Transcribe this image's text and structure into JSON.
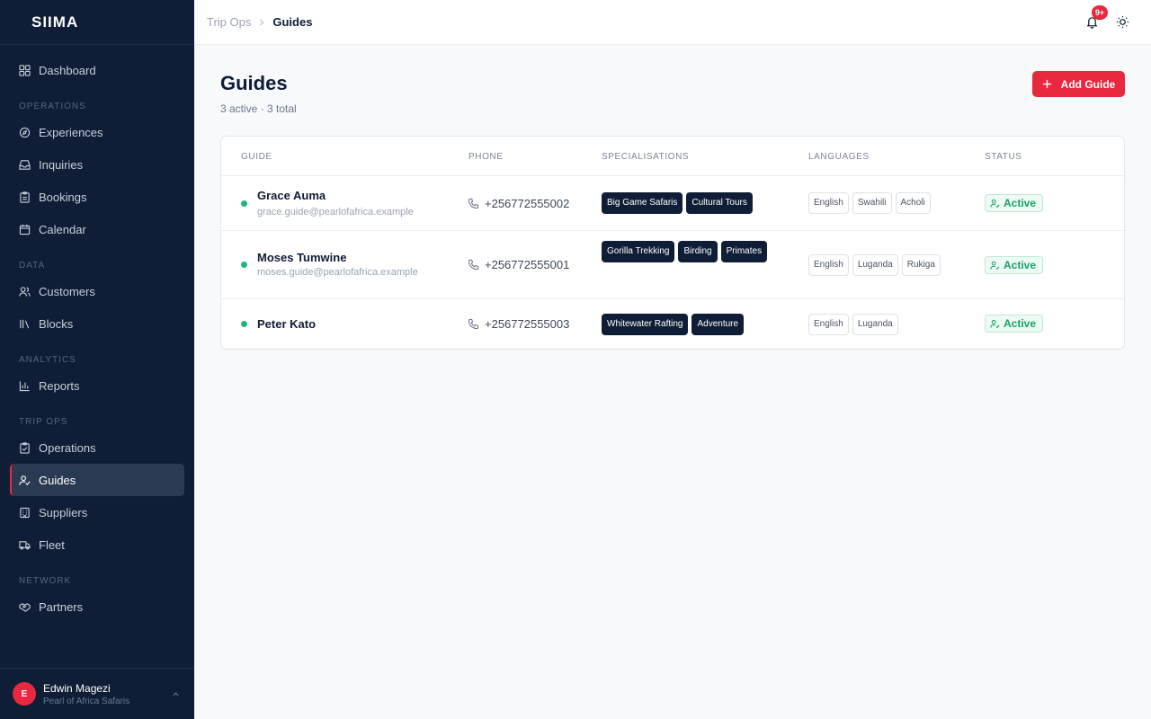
{
  "app": {
    "logo": "SIIMA"
  },
  "sidebar": {
    "dashboard": "Dashboard",
    "sections": {
      "operations": "OPERATIONS",
      "data": "DATA",
      "analytics": "ANALYTICS",
      "trip_ops": "TRIP OPS",
      "network": "NETWORK"
    },
    "items": {
      "experiences": "Experiences",
      "inquiries": "Inquiries",
      "bookings": "Bookings",
      "calendar": "Calendar",
      "customers": "Customers",
      "blocks": "Blocks",
      "reports": "Reports",
      "operations": "Operations",
      "guides": "Guides",
      "suppliers": "Suppliers",
      "fleet": "Fleet",
      "partners": "Partners"
    },
    "active": "guides",
    "user": {
      "initial": "E",
      "name": "Edwin Magezi",
      "org": "Pearl of Africa Safaris"
    }
  },
  "topbar": {
    "breadcrumb_parent": "Trip Ops",
    "breadcrumb_current": "Guides",
    "notification_count": "9+"
  },
  "main": {
    "title": "Guides",
    "subtitle": "3 active · 3 total",
    "add_button": "Add Guide"
  },
  "table": {
    "columns": {
      "guide": "GUIDE",
      "phone": "PHONE",
      "specialisations": "SPECIALISATIONS",
      "languages": "LANGUAGES",
      "status": "STATUS"
    },
    "rows": [
      {
        "name": "Grace Auma",
        "email": "grace.guide@pearlofafrica.example",
        "phone": "+256772555002",
        "specialisations": [
          "Big Game Safaris",
          "Cultural Tours"
        ],
        "languages": [
          "English",
          "Swahili",
          "Acholi"
        ],
        "status": "Active"
      },
      {
        "name": "Moses Tumwine",
        "email": "moses.guide@pearlofafrica.example",
        "phone": "+256772555001",
        "specialisations": [
          "Gorilla Trekking",
          "Birding",
          "Primates"
        ],
        "languages": [
          "English",
          "Luganda",
          "Rukiga"
        ],
        "status": "Active"
      },
      {
        "name": "Peter Kato",
        "email": "",
        "phone": "+256772555003",
        "specialisations": [
          "Whitewater Rafting",
          "Adventure"
        ],
        "languages": [
          "English",
          "Luganda"
        ],
        "status": "Active"
      }
    ]
  },
  "colors": {
    "accent": "#e8283e",
    "sidebar": "#0f1e36",
    "status_active": "#17a267"
  }
}
